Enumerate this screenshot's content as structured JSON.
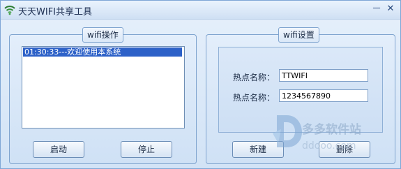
{
  "window": {
    "title": "天天WIFI共享工具",
    "min_glyph": "－",
    "close_glyph": "✕"
  },
  "left_panel": {
    "title": "wifi操作",
    "log": [
      "01:30:33---欢迎使用本系统"
    ],
    "start_button": "启动",
    "stop_button": "停止"
  },
  "right_panel": {
    "title": "wifi设置",
    "fields": [
      {
        "label": "热点名称：",
        "value": "TTWIFI"
      },
      {
        "label": "热点名称：",
        "value": "1234567890"
      }
    ],
    "new_button": "新建",
    "delete_button": "删除"
  },
  "watermark": {
    "text": "多多软件站",
    "url": "ddooo.com"
  },
  "icons": {
    "title": "wifi-icon",
    "minimize": "minimize-icon",
    "close": "close-icon",
    "watermark": "ddooo-logo-icon"
  },
  "colors": {
    "selection": "#2d61c8",
    "border": "#7fa4cf",
    "window_bg": "#d7e7f8"
  }
}
